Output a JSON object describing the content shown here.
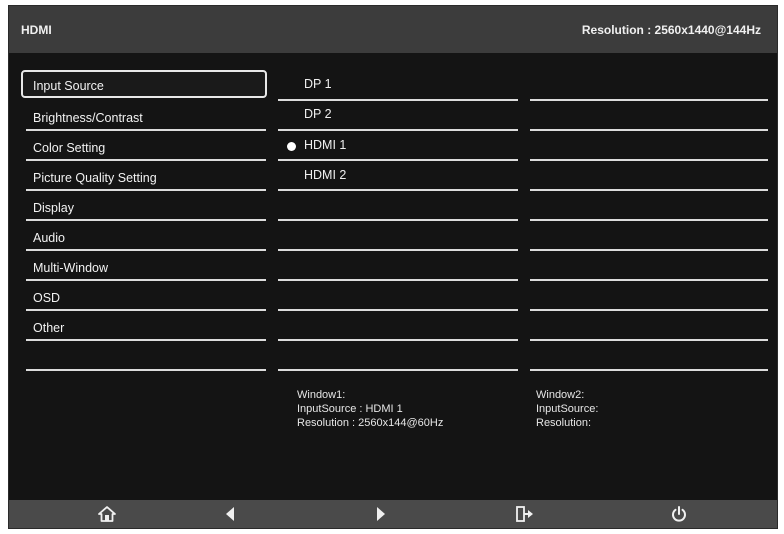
{
  "header": {
    "source": "HDMI",
    "resolution": "Resolution : 2560x1440@144Hz"
  },
  "menu": {
    "items": [
      {
        "label": "Input Source"
      },
      {
        "label": "Brightness/Contrast"
      },
      {
        "label": "Color Setting"
      },
      {
        "label": "Picture Quality Setting"
      },
      {
        "label": "Display"
      },
      {
        "label": "Audio"
      },
      {
        "label": "Multi-Window"
      },
      {
        "label": "OSD"
      },
      {
        "label": "Other"
      }
    ],
    "selected": "Input Source"
  },
  "options": {
    "items": [
      {
        "label": "DP 1"
      },
      {
        "label": "DP 2"
      },
      {
        "label": "HDMI 1"
      },
      {
        "label": "HDMI 2"
      }
    ],
    "selected": "HDMI 1"
  },
  "window1": {
    "title": "Window1:",
    "input_source": "InputSource : HDMI 1",
    "resolution": "Resolution :  2560x144@60Hz"
  },
  "window2": {
    "title": "Window2:",
    "input_source": "InputSource:",
    "resolution": "Resolution:"
  },
  "footer": {
    "icons": [
      "home-icon",
      "left-arrow-icon",
      "right-arrow-icon",
      "exit-icon",
      "power-icon"
    ]
  }
}
